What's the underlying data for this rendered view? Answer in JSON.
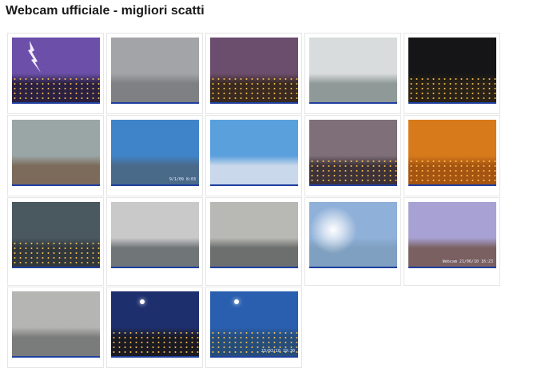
{
  "page": {
    "title": "Webcam ufficiale - migliori scatti"
  },
  "gallery": {
    "rows": [
      [
        {
          "name": "thumb-lightning-night",
          "sky": "#6b4fa8",
          "city": "#2b2040",
          "lights": true,
          "bolt": true
        },
        {
          "name": "thumb-rain-grey",
          "sky": "#a3a4a8",
          "city": "#7e8083"
        },
        {
          "name": "thumb-sunset-night",
          "sky": "#6b4d6e",
          "city": "#3a2a20",
          "lights": true
        },
        {
          "name": "thumb-fog-bright",
          "sky": "#d9dcdc",
          "city": "#8f9a98"
        },
        {
          "name": "thumb-fireworks",
          "sky": "#151517",
          "city": "#2a2217",
          "lights": true
        }
      ],
      [
        {
          "name": "thumb-clouds-day",
          "sky": "#9aa6a6",
          "city": "#7c6b5a"
        },
        {
          "name": "thumb-clear-blue",
          "sky": "#3f84c9",
          "city": "#4a6a8a",
          "stamp": "9/1/09 8:03"
        },
        {
          "name": "thumb-snow-blue",
          "sky": "#5aa0dd",
          "city": "#c9d8ea"
        },
        {
          "name": "thumb-dusk-city",
          "sky": "#7e6f78",
          "city": "#3d3238",
          "lights": true
        },
        {
          "name": "thumb-orange-storm",
          "sky": "#d77a1b",
          "city": "#a55412",
          "lights": true
        }
      ],
      [
        {
          "name": "thumb-dark-storm",
          "sky": "#4a5860",
          "city": "#31373b",
          "lights": true
        },
        {
          "name": "thumb-storm-bright",
          "sky": "#c9c9c9",
          "city": "#707577"
        },
        {
          "name": "thumb-rain-window",
          "sky": "#b8b8b4",
          "city": "#6c6f6d"
        },
        {
          "name": "thumb-sun-fog",
          "sky": "#8fb0d8",
          "city": "#7fa0c0",
          "glare": true
        },
        {
          "name": "thumb-haze-purple",
          "sky": "#a7a2d3",
          "city": "#7a6060",
          "stamp": "Webcam 21/06/10 16:23"
        }
      ],
      [
        {
          "name": "thumb-rain-drops",
          "sky": "#b5b5b3",
          "city": "#7a7c7b"
        },
        {
          "name": "thumb-moon-night",
          "sky": "#1e2f6e",
          "city": "#1b1a22",
          "lights": true,
          "moon": true
        },
        {
          "name": "thumb-moon-blue",
          "sky": "#2a5fb0",
          "city": "#264d7a",
          "lights": true,
          "moon": true,
          "stamp": "23/03/10 19:30"
        }
      ]
    ]
  }
}
